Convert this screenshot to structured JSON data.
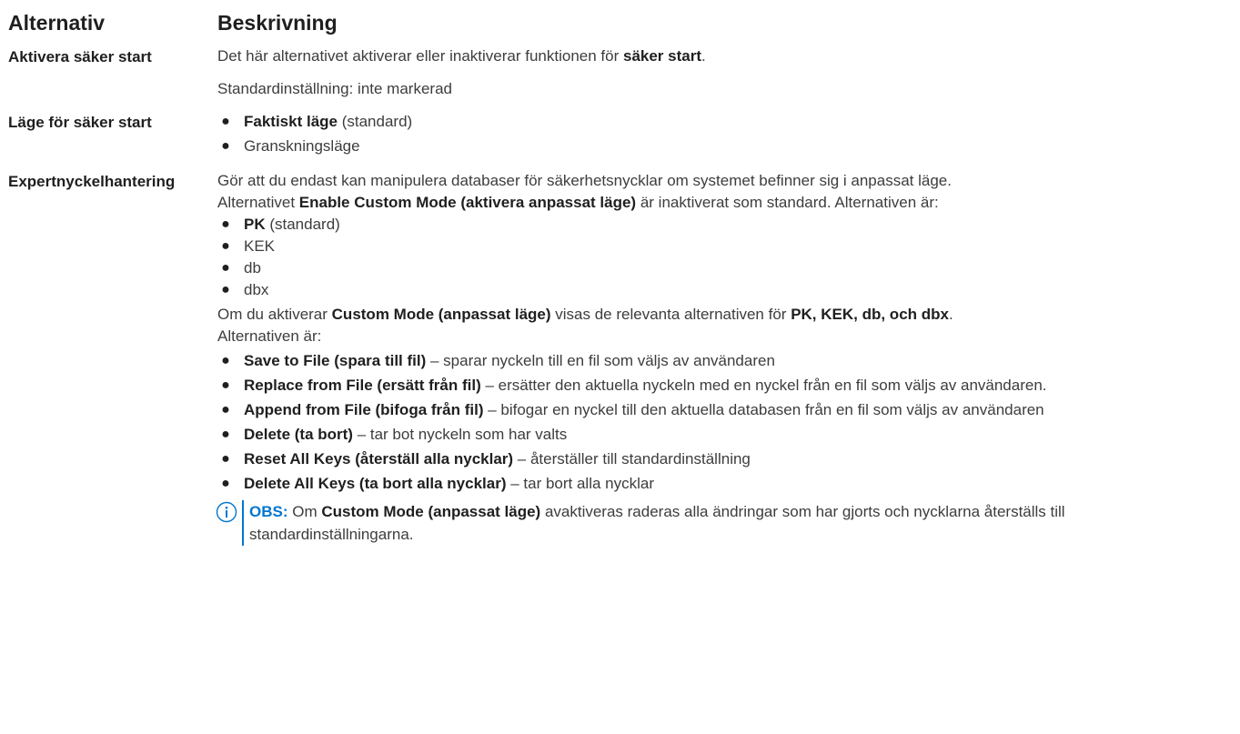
{
  "headers": {
    "option": "Alternativ",
    "description": "Beskrivning"
  },
  "rows": {
    "secure_boot": {
      "label": "Aktivera säker start",
      "desc_pre": "Det här alternativet aktiverar eller inaktiverar funktionen för ",
      "desc_bold": "säker start",
      "desc_post": ".",
      "default": "Standardinställning: inte markerad"
    },
    "secure_boot_mode": {
      "label": "Läge för säker start",
      "items": [
        {
          "bold": "Faktiskt läge",
          "text": " (standard)"
        },
        {
          "bold": "",
          "text": "Granskningsläge"
        }
      ]
    },
    "expert_key": {
      "label": "Expertnyckelhantering",
      "intro_1": "Gör att du endast kan manipulera databaser för säkerhetsnycklar om systemet befinner sig i anpassat läge.",
      "intro_2_pre": "Alternativet ",
      "intro_2_bold": "Enable Custom Mode (aktivera anpassat läge)",
      "intro_2_post": " är inaktiverat som standard. Alternativen är:",
      "keys": [
        {
          "bold": "PK",
          "text": " (standard)"
        },
        {
          "bold": "",
          "text": "KEK"
        },
        {
          "bold": "",
          "text": "db"
        },
        {
          "bold": "",
          "text": "dbx"
        }
      ],
      "custom_pre": "Om du aktiverar ",
      "custom_bold": "Custom Mode (anpassat läge)",
      "custom_mid": " visas de relevanta alternativen för ",
      "custom_bold_2": "PK, KEK, db, och dbx",
      "custom_post": ".",
      "custom_line_2": "Alternativen är:",
      "actions": [
        {
          "bold": "Save to File (spara till fil)",
          "text": " – sparar nyckeln till en fil som väljs av användaren"
        },
        {
          "bold": "Replace from File (ersätt från fil)",
          "text": " – ersätter den aktuella nyckeln med en nyckel från en fil som väljs av användaren."
        },
        {
          "bold": "Append from File (bifoga från fil)",
          "text": " – bifogar en nyckel till den aktuella databasen från en fil som väljs av användaren"
        },
        {
          "bold": "Delete (ta bort)",
          "text": " – tar bot nyckeln som har valts"
        },
        {
          "bold": "Reset All Keys (återställ alla nycklar)",
          "text": " – återställer till standardinställning"
        },
        {
          "bold": "Delete All Keys (ta bort alla nycklar)",
          "text": " – tar bort alla nycklar"
        }
      ],
      "note": {
        "icon": "info-icon",
        "label": "OBS:",
        "pre": " Om ",
        "bold": "Custom Mode (anpassat läge)",
        "post": " avaktiveras raderas alla ändringar som har gjorts och nycklarna återställs till standardinställningarna.",
        "color": "#0076ce"
      }
    }
  }
}
